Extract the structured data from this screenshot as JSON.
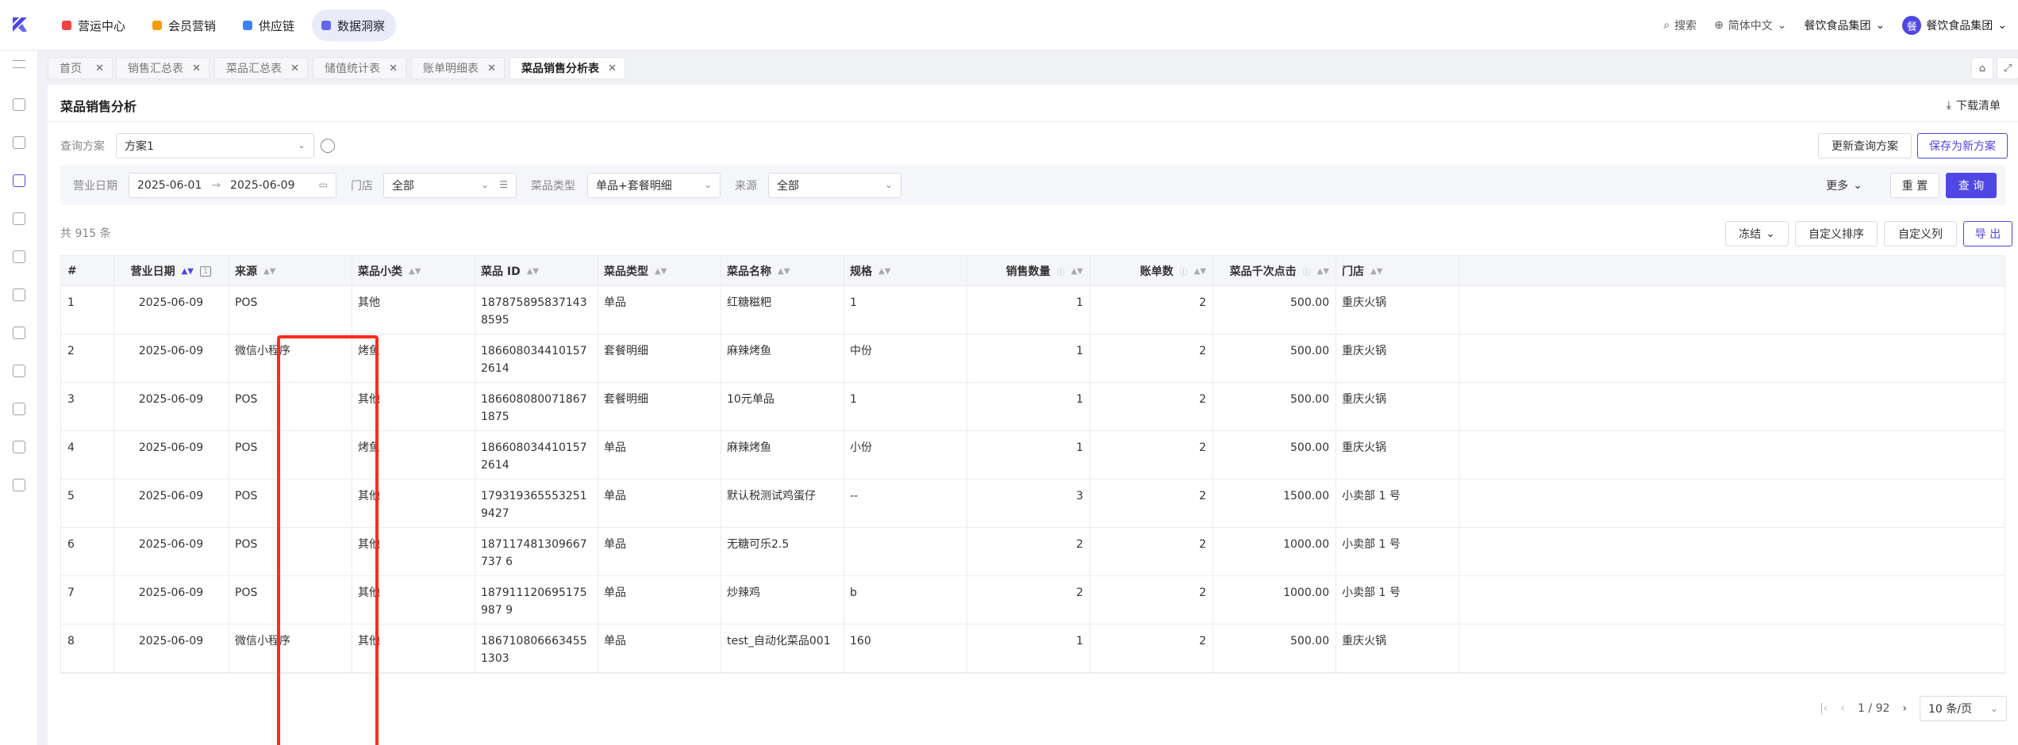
{
  "topnav": [
    {
      "label": "营运中心",
      "color": "#ef4444",
      "active": false
    },
    {
      "label": "会员营销",
      "color": "#f59e0b",
      "active": false
    },
    {
      "label": "供应链",
      "color": "#3b82f6",
      "active": false
    },
    {
      "label": "数据洞察",
      "color": "#6366f1",
      "active": true
    }
  ],
  "topright": {
    "search": "搜索",
    "language": "简体中文",
    "org_select": "餐饮食品集团",
    "avatar_char": "餐",
    "user_org": "餐饮食品集团"
  },
  "tabs": [
    {
      "label": "首页"
    },
    {
      "label": "销售汇总表"
    },
    {
      "label": "菜品汇总表"
    },
    {
      "label": "储值统计表"
    },
    {
      "label": "账单明细表"
    },
    {
      "label": "菜品销售分析表"
    }
  ],
  "page": {
    "title": "菜品销售分析",
    "download": "下载清单",
    "scheme_label": "查询方案",
    "scheme_value": "方案1",
    "update_scheme": "更新查询方案",
    "save_scheme": "保存为新方案"
  },
  "filters": {
    "date_label": "营业日期",
    "date_start": "2025-06-01",
    "date_arrow": "→",
    "date_end": "2025-06-09",
    "store_label": "门店",
    "store_value": "全部",
    "type_label": "菜品类型",
    "type_value": "单品+套餐明细",
    "source_label": "来源",
    "source_value": "全部",
    "more": "更多",
    "reset": "重 置",
    "query": "查 询"
  },
  "toolbar": {
    "count": "共 915 条",
    "freeze": "冻结",
    "custom_sort": "自定义排序",
    "custom_cols": "自定义列",
    "export": "导 出"
  },
  "table": {
    "headers": [
      "#",
      "营业日期",
      "来源",
      "菜品小类",
      "菜品 ID",
      "菜品类型",
      "菜品名称",
      "规格",
      "销售数量",
      "账单数",
      "菜品千次点击",
      "门店"
    ],
    "rows": [
      [
        "1",
        "2025-06-09",
        "POS",
        "其他",
        "1878758958371438595",
        "单品",
        "红糖糍粑",
        "1",
        "1",
        "2",
        "500.00",
        "重庆火锅"
      ],
      [
        "2",
        "2025-06-09",
        "微信小程序",
        "烤鱼",
        "1866080344101572614",
        "套餐明细",
        "麻辣烤鱼",
        "中份",
        "1",
        "2",
        "500.00",
        "重庆火锅"
      ],
      [
        "3",
        "2025-06-09",
        "POS",
        "其他",
        "1866080800718671875",
        "套餐明细",
        "10元单品",
        "1",
        "1",
        "2",
        "500.00",
        "重庆火锅"
      ],
      [
        "4",
        "2025-06-09",
        "POS",
        "烤鱼",
        "1866080344101572614",
        "单品",
        "麻辣烤鱼",
        "小份",
        "1",
        "2",
        "500.00",
        "重庆火锅"
      ],
      [
        "5",
        "2025-06-09",
        "POS",
        "其他",
        "1793193655532519427",
        "单品",
        "默认税测试鸡蛋仔",
        "--",
        "3",
        "2",
        "1500.00",
        "小卖部 1 号"
      ],
      [
        "6",
        "2025-06-09",
        "POS",
        "其他",
        "187117481309667737 6",
        "单品",
        "无糖可乐2.5",
        "",
        "2",
        "2",
        "1000.00",
        "小卖部 1 号"
      ],
      [
        "7",
        "2025-06-09",
        "POS",
        "其他",
        "187911120695175987 9",
        "单品",
        "炒辣鸡",
        "b",
        "2",
        "2",
        "1000.00",
        "小卖部 1 号"
      ],
      [
        "8",
        "2025-06-09",
        "微信小程序",
        "其他",
        "1867108066634551303",
        "单品",
        "test_自动化菜品001",
        "160",
        "1",
        "2",
        "500.00",
        "重庆火锅"
      ]
    ]
  },
  "pager": {
    "page": "1",
    "sep": "/",
    "total": "92",
    "size": "10 条/页"
  },
  "colors": {
    "accent": "#4f46e5",
    "highlight": "#ff2a1a"
  }
}
